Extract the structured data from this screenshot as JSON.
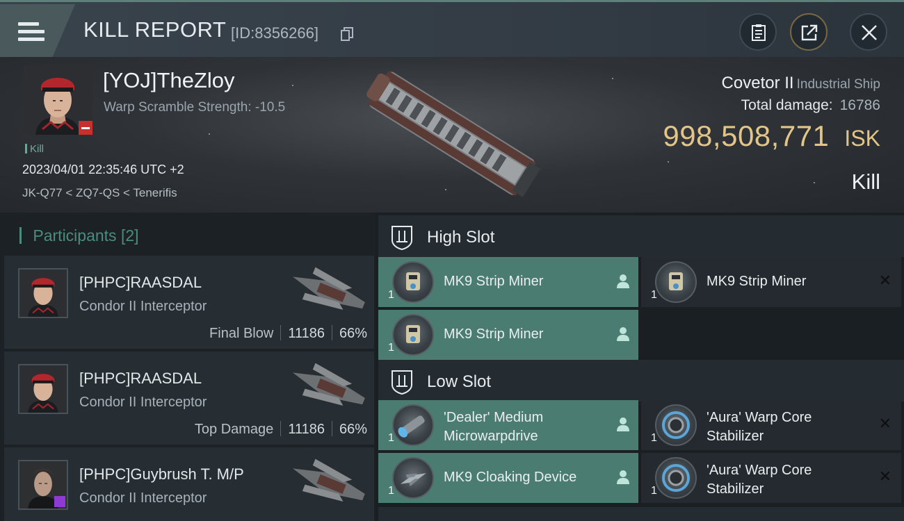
{
  "header": {
    "title": "KILL REPORT",
    "report_id": "[ID:8356266]"
  },
  "victim": {
    "name": "[YOJ]TheZloy",
    "warp_scramble": "Warp Scramble Strength: -10.5",
    "kill_tag": "Kill",
    "time": "2023/04/01 22:35:46 UTC +2",
    "location": "JK-Q77 < ZQ7-QS < Tenerifis",
    "ship_name": "Covetor II",
    "ship_class": "Industrial Ship",
    "total_damage_label": "Total damage:",
    "total_damage_value": "16786",
    "isk_value": "998,508,771",
    "isk_unit": "ISK",
    "result_label": "Kill"
  },
  "participants": {
    "label": "Participants",
    "count": "[2]",
    "rows": [
      {
        "name": "[PHPC]RAASDAL",
        "ship": "Condor II Interceptor",
        "role": "Final Blow",
        "damage": "11186",
        "percent": "66%"
      },
      {
        "name": "[PHPC]RAASDAL",
        "ship": "Condor II Interceptor",
        "role": "Top Damage",
        "damage": "11186",
        "percent": "66%"
      },
      {
        "name": "[PHPC]Guybrush T. M/P",
        "ship": "Condor II Interceptor"
      }
    ]
  },
  "slots": {
    "high": {
      "label": "High Slot",
      "modules": [
        {
          "name": "MK9 Strip Miner",
          "qty": "1"
        },
        {
          "name": "MK9 Strip Miner",
          "qty": "1"
        },
        {
          "name": "MK9 Strip Miner",
          "qty": "1"
        }
      ]
    },
    "low": {
      "label": "Low Slot",
      "modules": [
        {
          "name_l1": "'Dealer' Medium",
          "name_l2": "Microwarpdrive",
          "qty": "1"
        },
        {
          "name_l1": "'Aura' Warp Core",
          "name_l2": "Stabilizer",
          "qty": "1"
        },
        {
          "name": "MK9 Cloaking Device",
          "qty": "1"
        },
        {
          "name_l1": "'Aura' Warp Core",
          "name_l2": "Stabilizer",
          "qty": "1"
        }
      ]
    }
  },
  "colors": {
    "accent_teal": "#4a7c72",
    "isk_gold": "#e3c587",
    "participants_teal": "#4c8c7f"
  },
  "icons": [
    "menu-icon",
    "copy-icon",
    "clipboard-icon",
    "share-icon",
    "close-icon",
    "slot-icon",
    "person-icon",
    "remove-icon"
  ]
}
